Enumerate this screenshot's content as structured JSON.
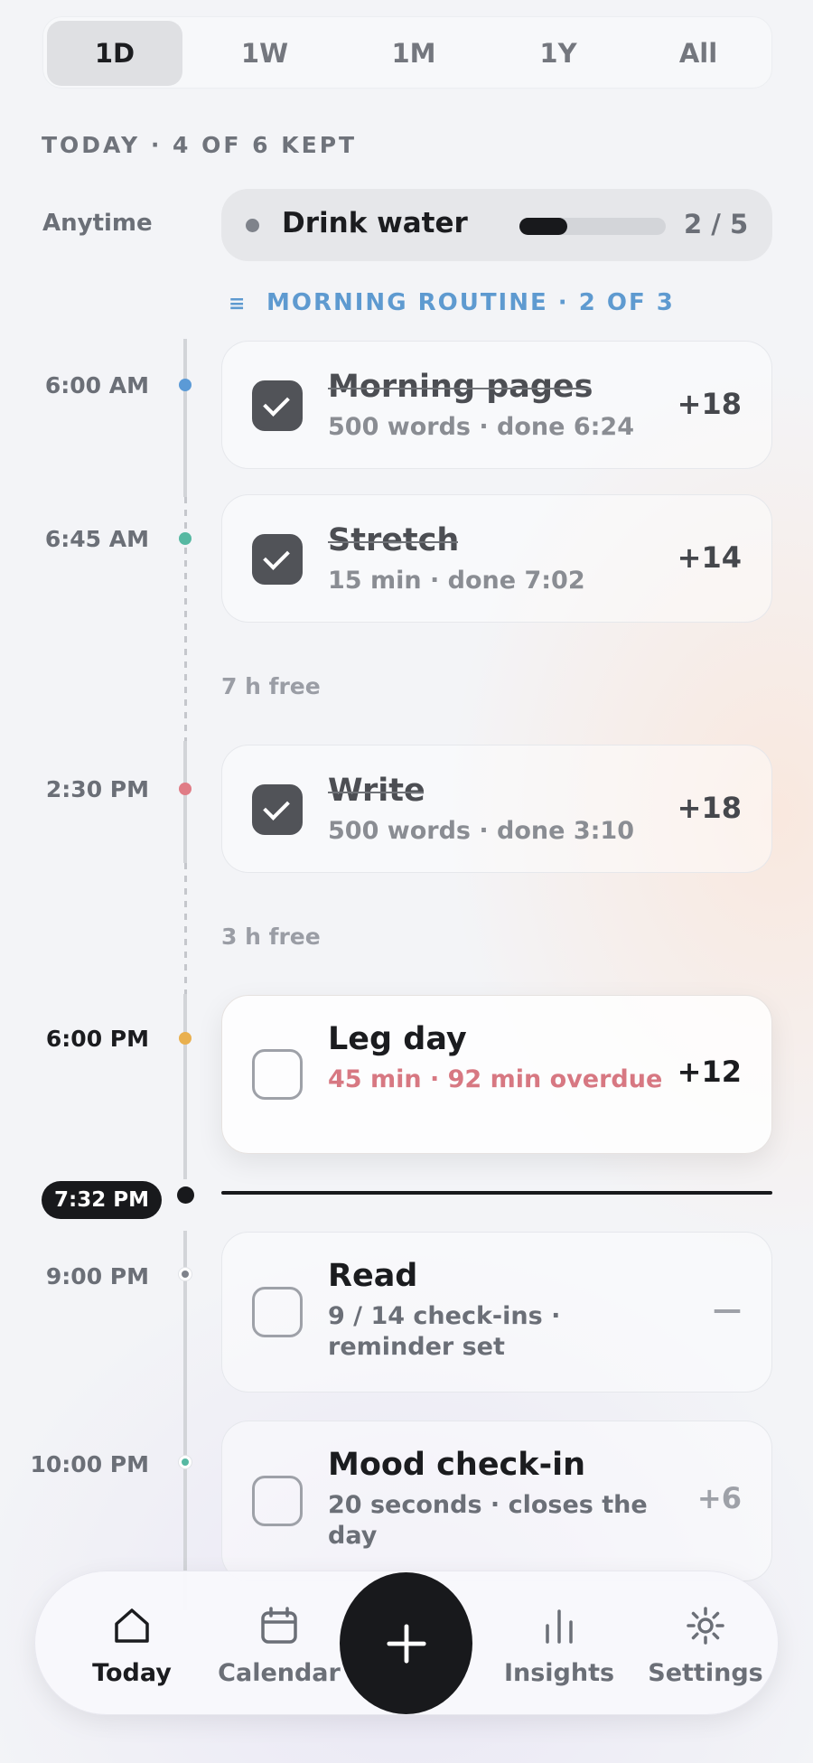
{
  "period_tabs": [
    {
      "label": "1D",
      "active": true
    },
    {
      "label": "1W",
      "active": false
    },
    {
      "label": "1M",
      "active": false
    },
    {
      "label": "1Y",
      "active": false
    },
    {
      "label": "All",
      "active": false
    }
  ],
  "today_header": "TODAY · 4 OF 6 KEPT",
  "anytime": {
    "label": "Anytime",
    "habit": "Drink water",
    "count": "2 / 5",
    "progress": 0.33
  },
  "routine_header": "MORNING ROUTINE · 2 OF 3",
  "timeline": {
    "times": [
      "6:00 AM",
      "6:45 AM",
      "2:30 PM",
      "6:00 PM",
      "9:00 PM",
      "10:00 PM"
    ],
    "free": [
      "7 h free",
      "3 h free"
    ],
    "now": "7:32 PM"
  },
  "tasks": [
    {
      "title": "Morning pages",
      "sub": "500 words · done 6:24",
      "points": "+18",
      "done": true,
      "dot_color": "#5b9ad6"
    },
    {
      "title": "Stretch",
      "sub": "15 min · done 7:02",
      "points": "+14",
      "done": true,
      "dot_color": "#56b8a2"
    },
    {
      "title": "Write",
      "sub": "500 words · done 3:10",
      "points": "+18",
      "done": true,
      "dot_color": "#e07c86"
    },
    {
      "title": "Leg day",
      "sub": "45 min · 92 min overdue",
      "points": "+12",
      "done": false,
      "dot_color": "#e9b04f"
    },
    {
      "title": "Read",
      "sub": "9 / 14 check-ins · reminder set",
      "points": "—",
      "done": false,
      "dot_color": "#7f838b"
    },
    {
      "title": "Mood check-in",
      "sub": "20 seconds · closes the day",
      "points": "+6",
      "done": false,
      "dot_color": "#56b8a2"
    }
  ],
  "nav": {
    "today": "Today",
    "calendar": "Calendar",
    "insights": "Insights",
    "settings": "Settings",
    "add_icon": "plus-icon"
  },
  "colors": {
    "accent_dark": "#18191c",
    "routine_blue": "#5e9ad0",
    "overdue": "#d77882"
  }
}
